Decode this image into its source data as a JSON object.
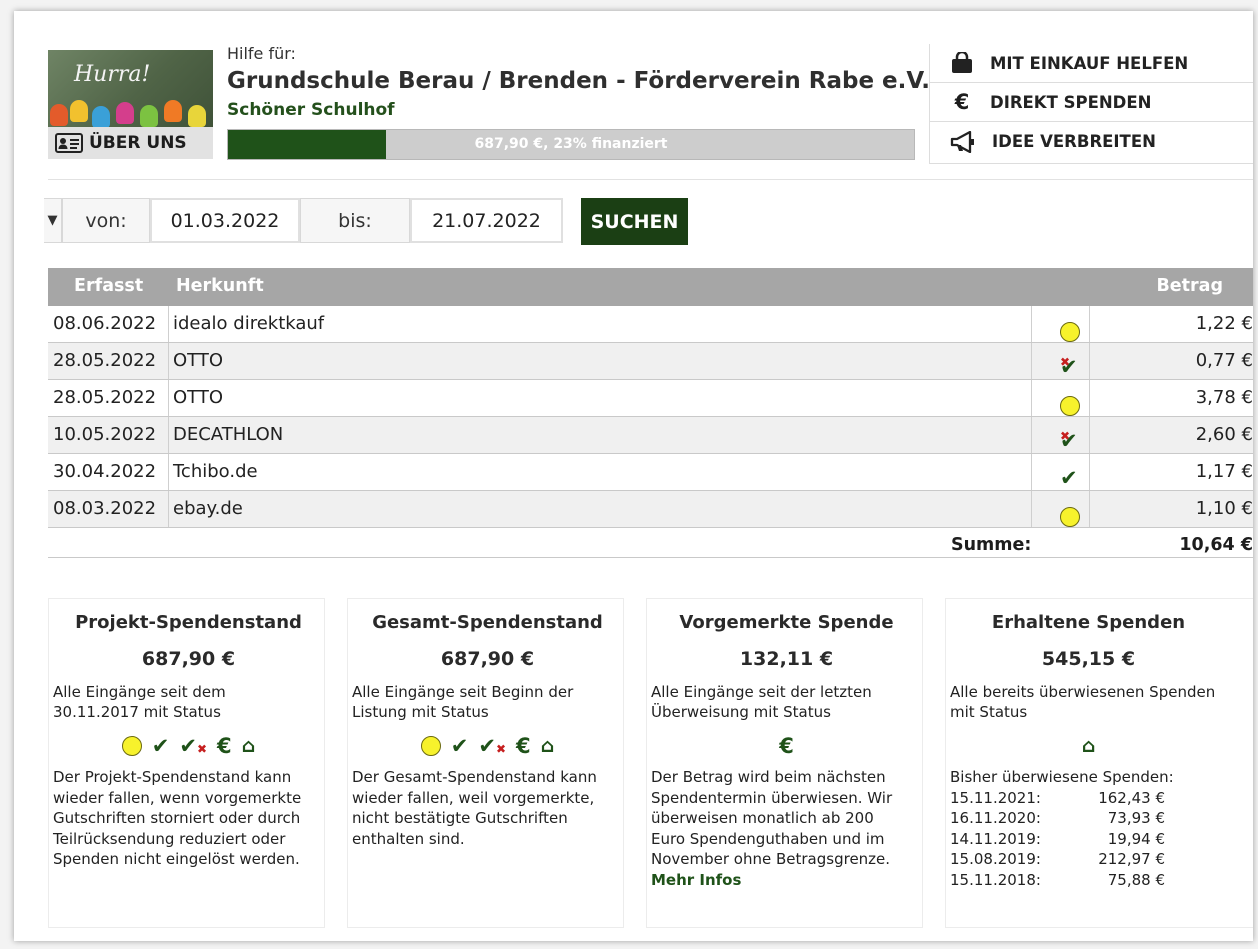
{
  "header": {
    "help_for": "Hilfe für:",
    "org_title": "Grundschule Berau / Brenden - Förderverein Rabe e.V.",
    "project": "Schöner Schulhof",
    "logo_text": "Hurra!",
    "about_label": "ÜBER UNS",
    "progress_text": "687,90 €, 23% finanziert",
    "progress_fraction": 0.23
  },
  "actions": [
    {
      "label": "MIT EINKAUF HELFEN",
      "icon": "shopping-bag-icon"
    },
    {
      "label": "DIREKT SPENDEN",
      "icon": "euro-icon"
    },
    {
      "label": "IDEE VERBREITEN",
      "icon": "megaphone-icon"
    }
  ],
  "filter": {
    "von_label": "von:",
    "von_value": "01.03.2022",
    "bis_label": "bis:",
    "bis_value": "21.07.2022",
    "search_label": "SUCHEN"
  },
  "table": {
    "headers": {
      "date": "Erfasst",
      "source": "Herkunft",
      "amount": "Betrag"
    },
    "rows": [
      {
        "date": "08.06.2022",
        "source": "idealo direktkauf",
        "status": "pending",
        "amount": "1,22 €"
      },
      {
        "date": "28.05.2022",
        "source": "OTTO",
        "status": "partial",
        "amount": "0,77 €"
      },
      {
        "date": "28.05.2022",
        "source": "OTTO",
        "status": "pending",
        "amount": "3,78 €"
      },
      {
        "date": "10.05.2022",
        "source": "DECATHLON",
        "status": "partial",
        "amount": "2,60 €"
      },
      {
        "date": "30.04.2022",
        "source": "Tchibo.de",
        "status": "confirmed",
        "amount": "1,17 €"
      },
      {
        "date": "08.03.2022",
        "source": "ebay.de",
        "status": "pending",
        "amount": "1,10 €"
      }
    ],
    "sum_label": "Summe:",
    "sum_value": "10,64 €"
  },
  "cards": [
    {
      "title": "Projekt-Spendenstand",
      "value": "687,90 €",
      "desc": "Alle Eingänge seit dem 30.11.2017 mit Status",
      "extra": "Der Projekt-Spendenstand kann wieder fallen, wenn vorgemerkte Gutschriften storniert oder durch Teilrücksendung reduziert oder Spenden nicht eingelöst werden."
    },
    {
      "title": "Gesamt-Spendenstand",
      "value": "687,90 €",
      "desc": "Alle Eingänge seit Beginn der Listung mit Status",
      "extra": "Der Gesamt-Spendenstand kann wieder fallen, weil vorgemerkte, nicht bestätigte Gutschriften enthalten sind."
    },
    {
      "title": "Vorgemerkte Spende",
      "value": "132,11 €",
      "desc": "Alle Eingänge seit der letzten Überweisung mit Status",
      "extra": "Der Betrag wird beim nächsten Spendentermin überwiesen. Wir überweisen monatlich ab 200 Euro Spendenguthaben und im November ohne Betragsgrenze.",
      "more_label": "Mehr Infos"
    },
    {
      "title": "Erhaltene Spenden",
      "value": "545,15 €",
      "desc": "Alle bereits überwiesenen Spenden mit Status",
      "history_label": "Bisher überwiesene Spenden:",
      "history": [
        {
          "date": "15.11.2021:",
          "amount": "162,43 €"
        },
        {
          "date": "16.11.2020:",
          "amount": "73,93 €"
        },
        {
          "date": "14.11.2019:",
          "amount": "19,94 €"
        },
        {
          "date": "15.08.2019:",
          "amount": "212,97 €"
        },
        {
          "date": "15.11.2018:",
          "amount": "75,88 €"
        }
      ]
    }
  ],
  "colors": {
    "brand_green": "#1f5219",
    "pending_yellow": "#f7f22c",
    "header_gray": "#a6a6a6"
  }
}
